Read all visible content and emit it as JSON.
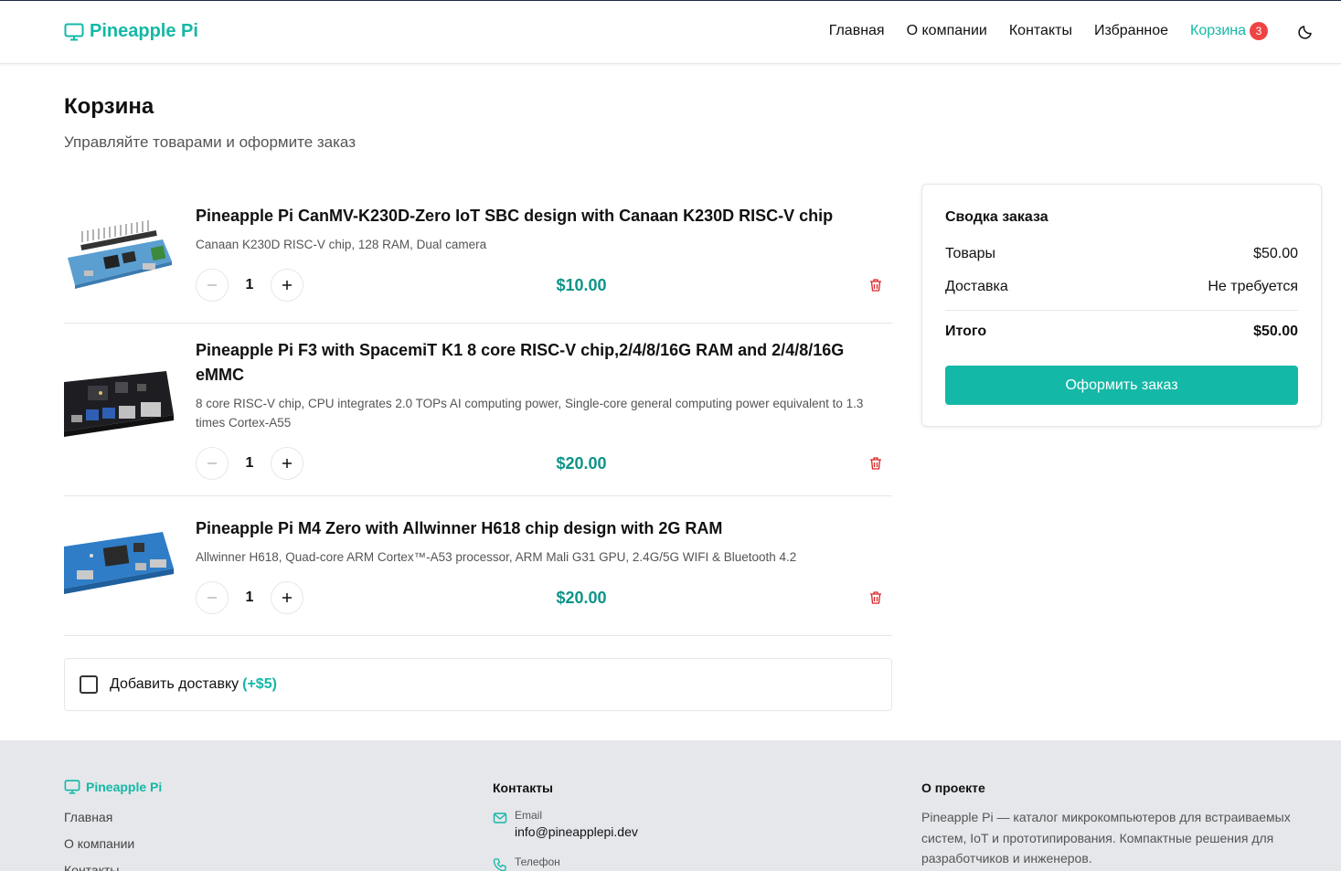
{
  "header": {
    "brand": "Pineapple Pi",
    "nav": [
      {
        "label": "Главная"
      },
      {
        "label": "О компании"
      },
      {
        "label": "Контакты"
      },
      {
        "label": "Избранное"
      },
      {
        "label": "Корзина",
        "badge": "3"
      }
    ]
  },
  "page": {
    "title": "Корзина",
    "subtitle": "Управляйте товарами и оформите заказ"
  },
  "cart": {
    "items": [
      {
        "name": "Pineapple Pi CanMV-K230D-Zero IoT SBC design with Canaan K230D RISC-V chip",
        "description": "Canaan K230D RISC-V chip, 128 RAM, Dual camera",
        "quantity": "1",
        "price": "$10.00"
      },
      {
        "name": "Pineapple Pi F3 with SpacemiT K1 8 core RISC-V chip,2/4/8/16G RAM and 2/4/8/16G eMMC",
        "description": "8 core RISC-V chip, CPU integrates 2.0 TOPs AI computing power, Single-core general computing power equivalent to 1.3 times Cortex-A55",
        "quantity": "1",
        "price": "$20.00"
      },
      {
        "name": "Pineapple Pi M4 Zero with Allwinner H618 chip design with 2G RAM",
        "description": "Allwinner H618, Quad-core ARM Cortex™-A53 processor, ARM Mali G31 GPU, 2.4G/5G WIFI & Bluetooth 4.2",
        "quantity": "1",
        "price": "$20.00"
      }
    ],
    "delivery": {
      "label": "Добавить доставку",
      "extra": "(+$5)",
      "checked": false
    }
  },
  "summary": {
    "title": "Сводка заказа",
    "goods_label": "Товары",
    "goods_value": "$50.00",
    "shipping_label": "Доставка",
    "shipping_value": "Не требуется",
    "total_label": "Итого",
    "total_value": "$50.00",
    "checkout_label": "Оформить заказ"
  },
  "footer": {
    "brand": "Pineapple Pi",
    "links": [
      "Главная",
      "О компании",
      "Контакты"
    ],
    "contacts_title": "Контакты",
    "email_label": "Email",
    "email_value": "info@pineapplepi.dev",
    "phone_label": "Телефон",
    "about_title": "О проекте",
    "about_text": "Pineapple Pi — каталог микрокомпьютеров для встраиваемых систем, IoT и прототипирования. Компактные решения для разработчиков и инженеров."
  },
  "colors": {
    "accent": "#14b8a6",
    "price": "#0d9488",
    "badge": "#ef4444",
    "danger": "#dc2626"
  },
  "icons": {
    "brand": "monitor-icon",
    "theme": "moon-icon",
    "remove": "trash-icon",
    "decrease": "minus-icon",
    "increase": "plus-icon",
    "email": "mail-icon",
    "phone": "phone-icon"
  }
}
